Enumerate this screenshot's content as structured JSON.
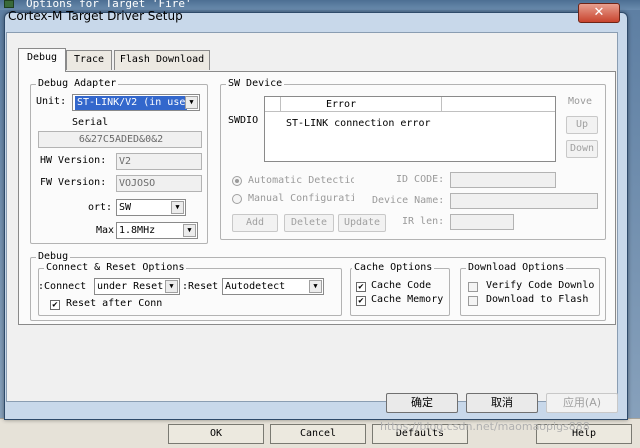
{
  "parent": {
    "title": "Options for Target 'Fire'",
    "ok_label": "OK",
    "cancel_label": "Cancel",
    "defaults_label": "Defaults",
    "help_label": "Help"
  },
  "dialog": {
    "title": "Cortex-M Target Driver Setup",
    "close_label": "✕"
  },
  "tabs": [
    {
      "label": "Debug",
      "active": true
    },
    {
      "label": "Trace",
      "active": false
    },
    {
      "label": "Flash Download",
      "active": false
    }
  ],
  "debug_adapter": {
    "legend": "Debug Adapter",
    "unit_label": "Unit:",
    "unit_value": "ST-LINK/V2 (in use",
    "serial_label": "Serial",
    "serial_value": "6&27C5ADED&0&2",
    "hw_version_label": "HW Version:",
    "hw_version_value": "V2",
    "fw_version_label": "FW Version:",
    "fw_version_value": "VOJOSO",
    "port_label": "ort:",
    "port_value": "SW",
    "max_label": "Max",
    "max_value": "1.8MHz"
  },
  "sw_device": {
    "legend": "SW Device",
    "swdio_label": "SWDIO",
    "error_header": "Error",
    "error_message": "ST-LINK connection error",
    "move_label": "Move",
    "up_label": "Up",
    "down_label": "Down",
    "auto_detect_label": "Automatic Detectio",
    "manual_config_label": "Manual Configurati",
    "id_code_label": "ID CODE:",
    "device_name_label": "Device Name:",
    "ir_len_label": "IR len:",
    "add_label": "Add",
    "delete_label": "Delete",
    "update_label": "Update"
  },
  "debug": {
    "legend": "Debug",
    "connect_reset_legend": "Connect & Reset Options",
    "connect_label": "Connect:",
    "connect_value": "under Reset",
    "reset_label": "Reset:",
    "reset_value": "Autodetect",
    "reset_after_conn_label": "Reset after Conn",
    "reset_after_conn_checked": true,
    "cache_legend": "Cache Options",
    "cache_code_label": "Cache Code",
    "cache_code_checked": true,
    "cache_memory_label": "Cache Memory",
    "cache_memory_checked": true,
    "download_legend": "Download Options",
    "verify_label": "Verify Code Downlo",
    "verify_checked": false,
    "download_flash_label": "Download to Flash",
    "download_flash_checked": false
  },
  "footer": {
    "ok_label": "确定",
    "cancel_label": "取消",
    "apply_label": "应用(A)"
  },
  "watermark": "https://blog.csdn.net/maomaopigs888"
}
